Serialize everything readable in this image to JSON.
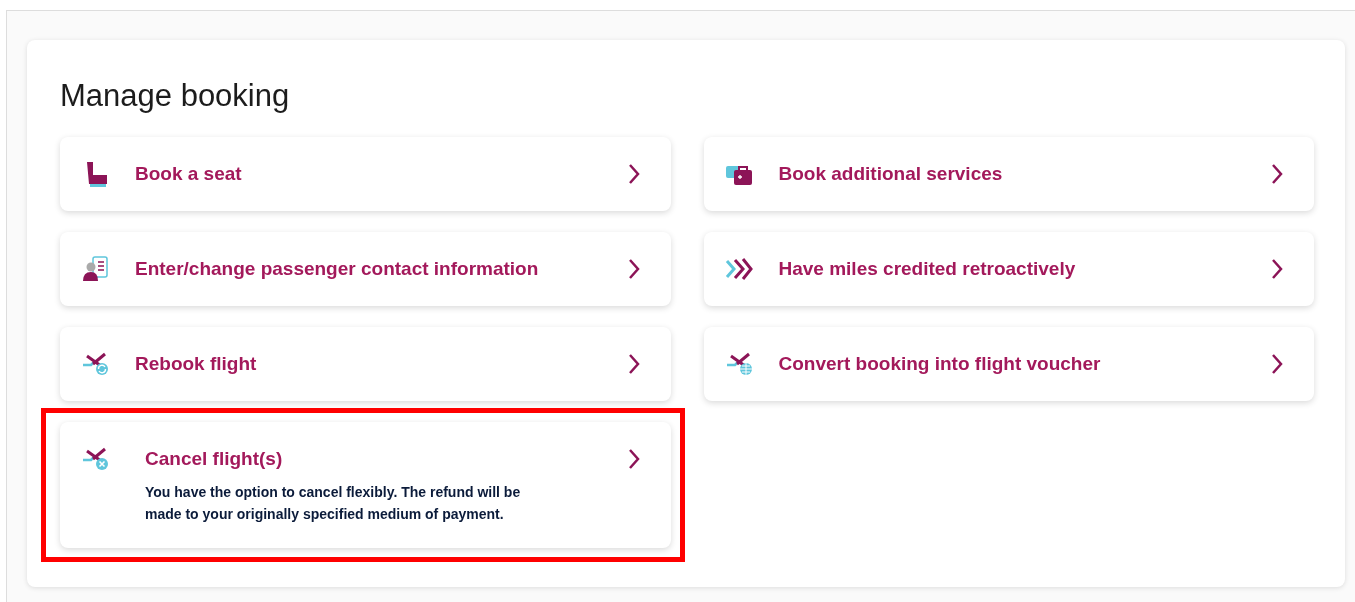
{
  "title": "Manage booking",
  "items": [
    {
      "label": "Book a seat",
      "kind": "seat",
      "highlighted": false
    },
    {
      "label": "Book additional services",
      "kind": "luggage",
      "highlighted": false
    },
    {
      "label": "Enter/change passenger contact information",
      "kind": "contact",
      "highlighted": false
    },
    {
      "label": "Have miles credited retroactively",
      "kind": "miles",
      "highlighted": false
    },
    {
      "label": "Rebook flight",
      "kind": "rebook",
      "highlighted": false
    },
    {
      "label": "Convert booking into flight voucher",
      "kind": "voucher",
      "highlighted": false
    },
    {
      "label": "Cancel flight(s)",
      "kind": "cancel",
      "highlighted": true,
      "description": "You have the option to cancel flexibly. The refund will be made to your originally specified medium of payment."
    }
  ]
}
